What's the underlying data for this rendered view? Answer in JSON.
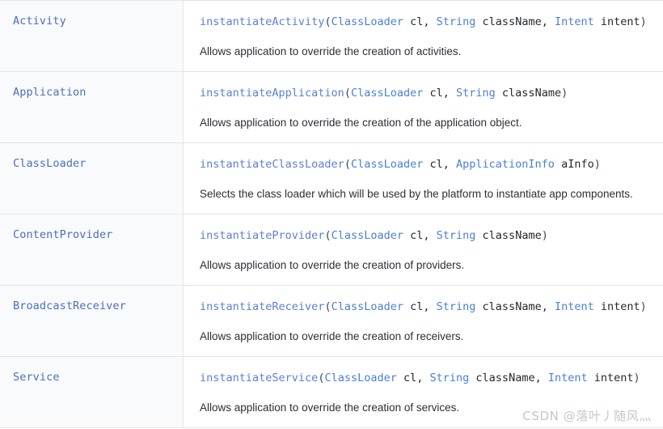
{
  "table": {
    "rows": [
      {
        "class_name": "Activity",
        "signature": {
          "method": "instantiateActivity",
          "open_paren": "(",
          "params": [
            {
              "type": "ClassLoader",
              "name": " cl"
            },
            {
              "type": "String",
              "name": " className"
            },
            {
              "type": "Intent",
              "name": " intent"
            }
          ],
          "close_paren": ")",
          "separator": ", ",
          "full_text": "instantiateActivity(ClassLoader cl, String className, Intent intent)"
        },
        "description": "Allows application to override the creation of activities."
      },
      {
        "class_name": "Application",
        "signature": {
          "method": "instantiateApplication",
          "open_paren": "(",
          "params": [
            {
              "type": "ClassLoader",
              "name": " cl"
            },
            {
              "type": "String",
              "name": " className"
            }
          ],
          "close_paren": ")",
          "separator": ", ",
          "full_text": "instantiateApplication(ClassLoader cl, String className)"
        },
        "description": "Allows application to override the creation of the application object."
      },
      {
        "class_name": "ClassLoader",
        "signature": {
          "method": "instantiateClassLoader",
          "open_paren": "(",
          "params": [
            {
              "type": "ClassLoader",
              "name": " cl"
            },
            {
              "type": "ApplicationInfo",
              "name": " aInfo"
            }
          ],
          "close_paren": ")",
          "separator": ", ",
          "full_text": "instantiateClassLoader(ClassLoader cl, ApplicationInfo aInfo)"
        },
        "description": "Selects the class loader which will be used by the platform to instantiate app components."
      },
      {
        "class_name": "ContentProvider",
        "signature": {
          "method": "instantiateProvider",
          "open_paren": "(",
          "params": [
            {
              "type": "ClassLoader",
              "name": " cl"
            },
            {
              "type": "String",
              "name": " className"
            }
          ],
          "close_paren": ")",
          "separator": ", ",
          "full_text": "instantiateProvider(ClassLoader cl, String className)"
        },
        "description": "Allows application to override the creation of providers."
      },
      {
        "class_name": "BroadcastReceiver",
        "signature": {
          "method": "instantiateReceiver",
          "open_paren": "(",
          "params": [
            {
              "type": "ClassLoader",
              "name": " cl"
            },
            {
              "type": "String",
              "name": " className"
            },
            {
              "type": "Intent",
              "name": " intent"
            }
          ],
          "close_paren": ")",
          "separator": ", ",
          "full_text": "instantiateReceiver(ClassLoader cl, String className, Intent intent)"
        },
        "description": "Allows application to override the creation of receivers."
      },
      {
        "class_name": "Service",
        "signature": {
          "method": "instantiateService",
          "open_paren": "(",
          "params": [
            {
              "type": "ClassLoader",
              "name": " cl"
            },
            {
              "type": "String",
              "name": " className"
            },
            {
              "type": "Intent",
              "name": " intent"
            }
          ],
          "close_paren": ")",
          "separator": ", ",
          "full_text": "instantiateService(ClassLoader cl, String className, Intent intent)"
        },
        "description": "Allows application to override the creation of services."
      }
    ]
  },
  "watermark": {
    "text": "CSDN @落叶丿随风灬"
  },
  "colors": {
    "class_name": "#4a6fc1",
    "method": "#5b7fd4",
    "type": "#4a7fd6",
    "plain_code": "#24292f",
    "description": "#2b2f36",
    "row_border": "#e3e5e8",
    "left_column_bg": "#f9fafb",
    "right_column_bg": "#ffffff",
    "watermark": "#c3c6cc"
  }
}
